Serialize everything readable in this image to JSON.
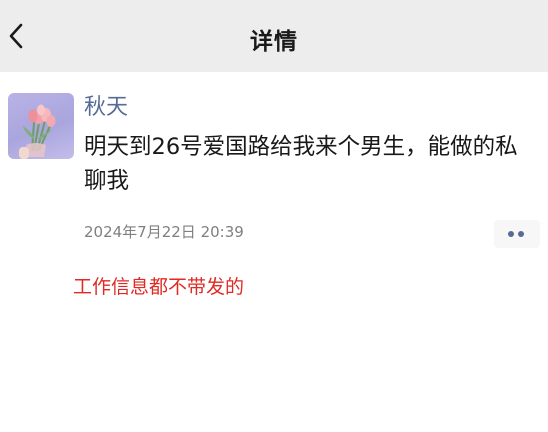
{
  "header": {
    "back_icon": "chevron-left-icon",
    "title": "详情"
  },
  "post": {
    "avatar_icon": "tulip-bouquet-avatar",
    "username": "秋天",
    "content": "明天到26号爱国路给我来个男生，能做的私聊我",
    "timestamp": "2024年7月22日 20:39",
    "more_icon": "more-dots-icon"
  },
  "annotation": {
    "text": "工作信息都不带发的",
    "color": "#e02a24"
  },
  "colors": {
    "nav_background": "#ededed",
    "username": "#576b95",
    "annotation": "#e02a24"
  }
}
